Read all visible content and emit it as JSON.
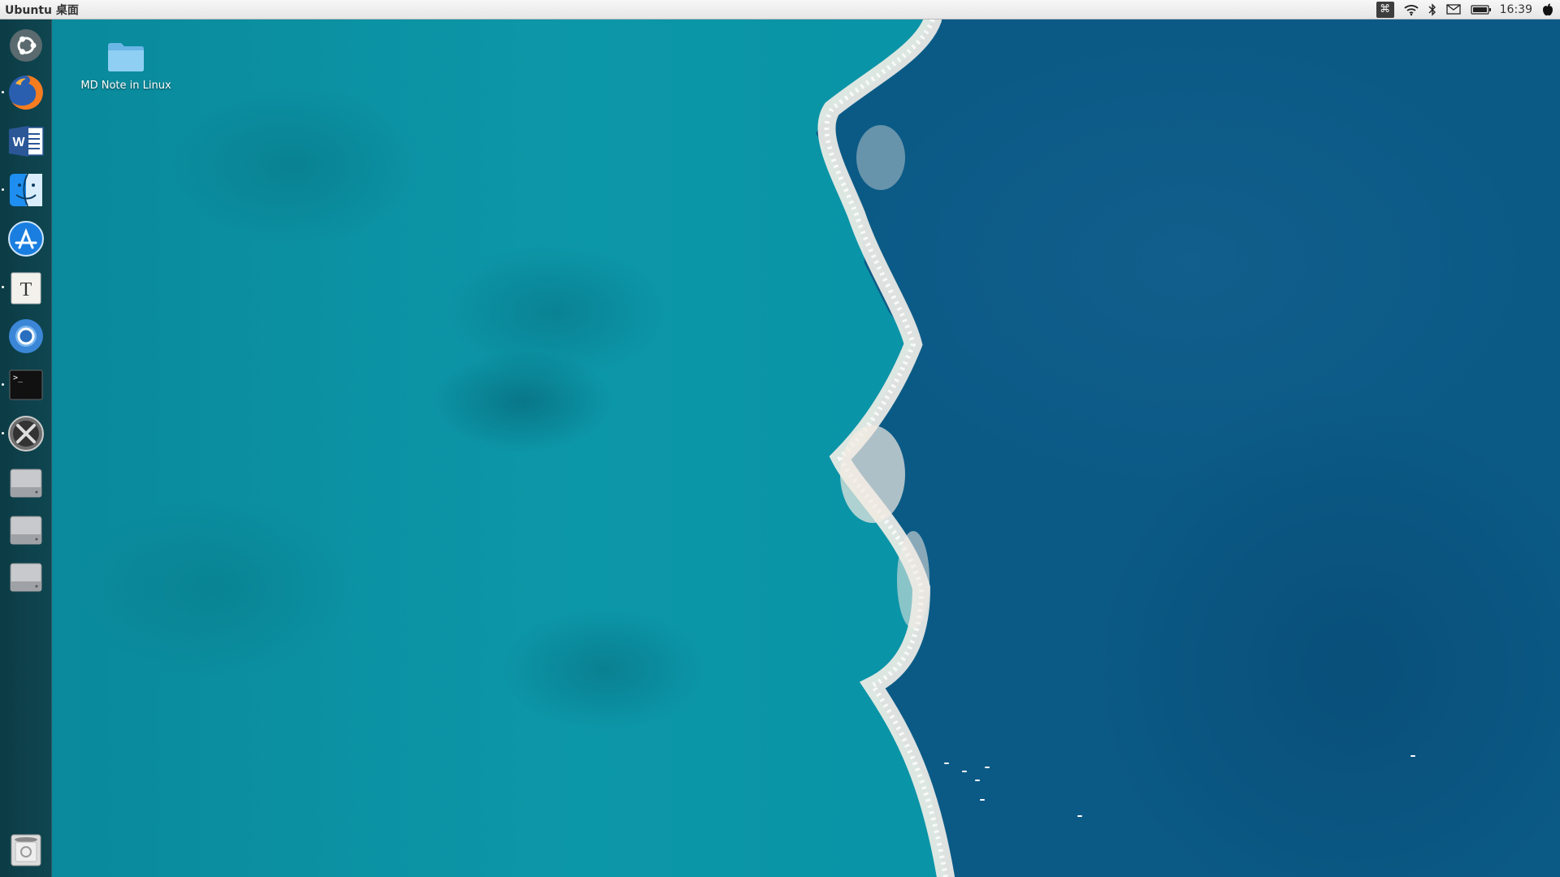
{
  "top_panel": {
    "title": "Ubuntu 桌面",
    "clock": "16:39",
    "indicators": [
      "command-icon",
      "wifi-icon",
      "bluetooth-icon",
      "mail-icon",
      "battery-icon",
      "apple-icon"
    ]
  },
  "launcher": {
    "items": [
      {
        "name": "ubuntu-dash",
        "icon": "ubuntu-logo-icon"
      },
      {
        "name": "firefox",
        "icon": "firefox-icon",
        "running": true
      },
      {
        "name": "word",
        "icon": "word-icon"
      },
      {
        "name": "finder",
        "icon": "finder-icon",
        "running": true
      },
      {
        "name": "app-store",
        "icon": "app-store-icon"
      },
      {
        "name": "text-editor",
        "icon": "text-editor-icon",
        "running": true
      },
      {
        "name": "chromium",
        "icon": "chromium-icon"
      },
      {
        "name": "terminal",
        "icon": "terminal-icon",
        "running": true
      },
      {
        "name": "system-settings",
        "icon": "system-settings-icon",
        "running": true
      },
      {
        "name": "drive-1",
        "icon": "hard-drive-icon"
      },
      {
        "name": "drive-2",
        "icon": "hard-drive-icon"
      },
      {
        "name": "drive-3",
        "icon": "hard-drive-icon"
      },
      {
        "name": "trash",
        "icon": "trash-icon"
      }
    ]
  },
  "desktop": {
    "icons": [
      {
        "label": "MD Note in Linux",
        "icon": "folder-icon"
      }
    ]
  },
  "colors": {
    "shallow_water": "#0a93a5",
    "deep_water": "#0b5a86",
    "launcher_bg": "#0f4650",
    "panel_bg": "#ededed",
    "folder": "#7cc4ef"
  }
}
